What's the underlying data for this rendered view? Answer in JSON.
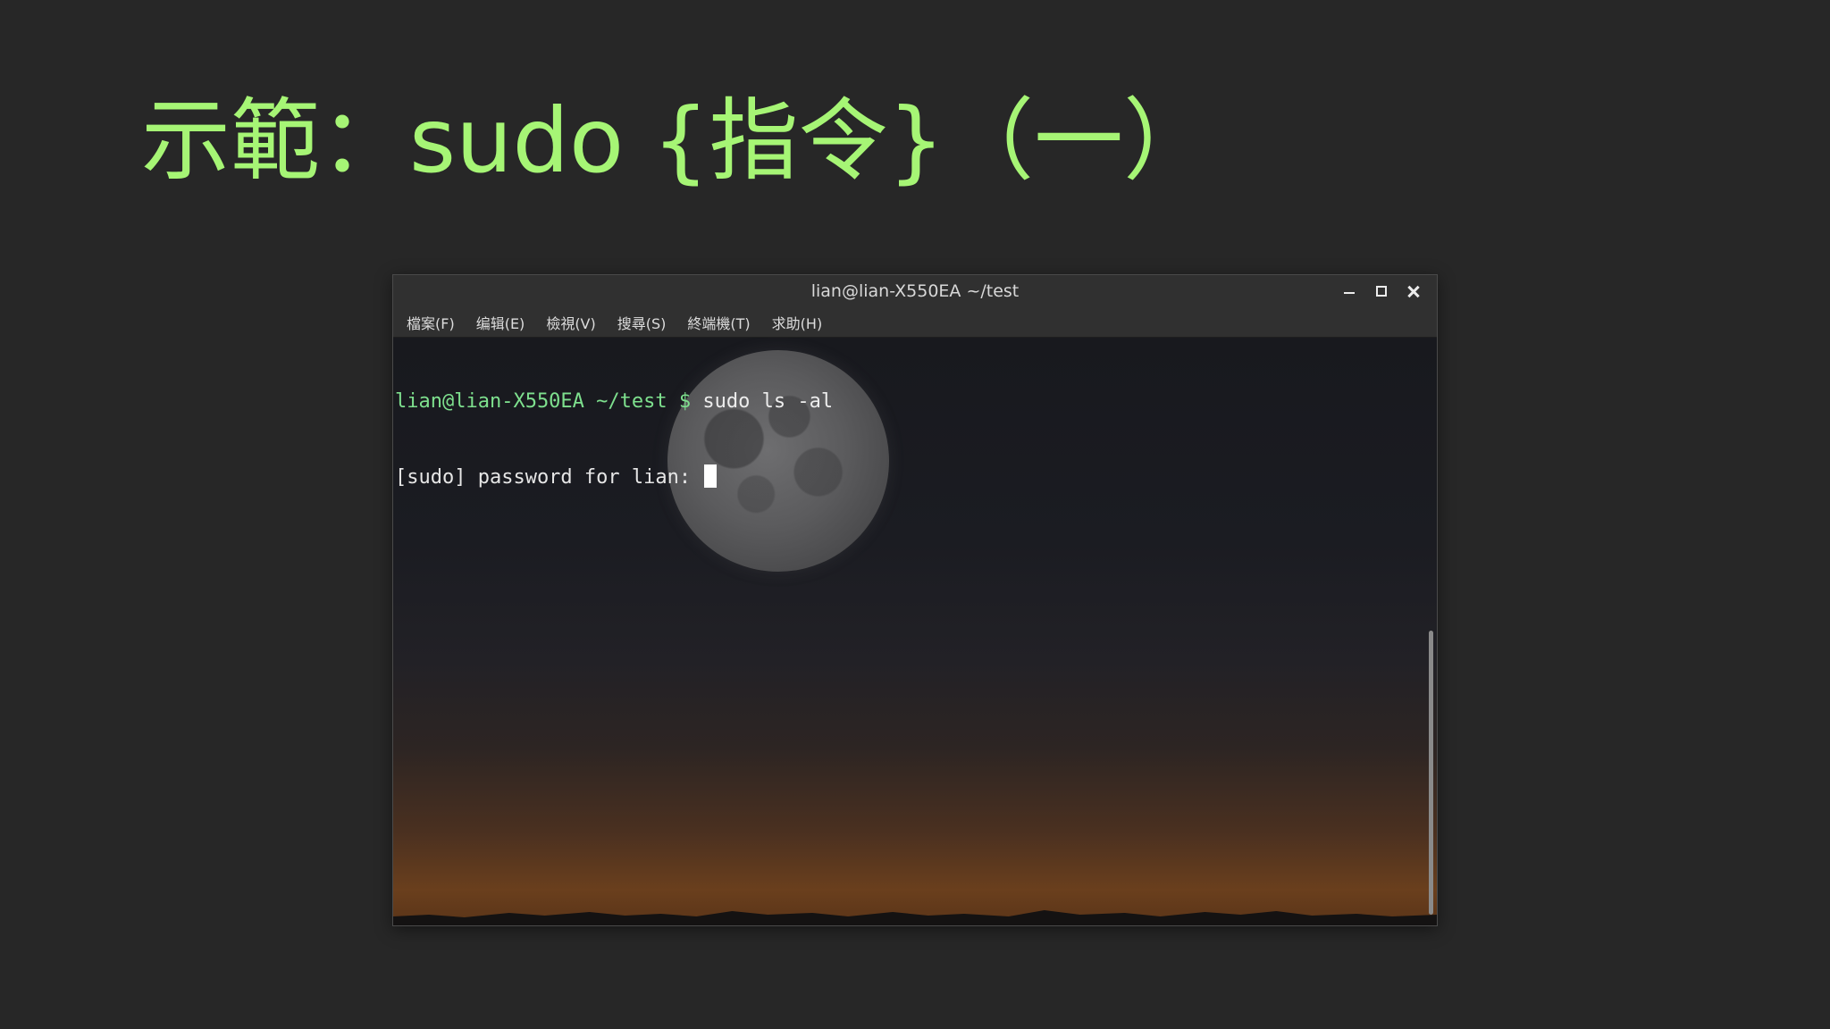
{
  "slide": {
    "title": "示範：sudo {指令}（一）",
    "title_color": "#a6f575"
  },
  "window": {
    "title": "lian@lian-X550EA ~/test",
    "controls": {
      "minimize": "minimize-icon",
      "maximize": "maximize-icon",
      "close": "close-icon"
    }
  },
  "menu": {
    "items": [
      {
        "label": "檔案(F)"
      },
      {
        "label": "编辑(E)"
      },
      {
        "label": "檢視(V)"
      },
      {
        "label": "搜尋(S)"
      },
      {
        "label": "終端機(T)"
      },
      {
        "label": "求助(H)"
      }
    ]
  },
  "terminal": {
    "line1": {
      "prompt": "lian@lian-X550EA ~/test $ ",
      "command": "sudo ls -al"
    },
    "line2": {
      "text": "[sudo] password for lian: "
    },
    "prompt_color": "#7ee08e"
  },
  "background": {
    "wallpaper_icon": "moon-icon"
  }
}
